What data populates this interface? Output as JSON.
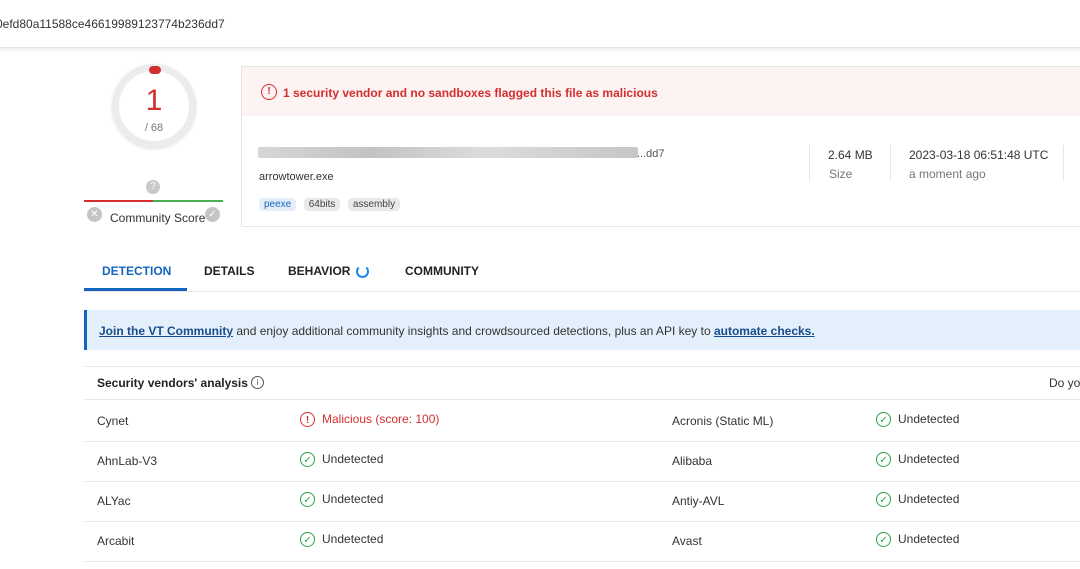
{
  "header": {
    "hash": "0efd80a11588ce46619989123774b236dd7"
  },
  "score": {
    "detections": "1",
    "total": "/ 68",
    "community_label": "Community Score",
    "question_icon": "?"
  },
  "file": {
    "alert": "1 security vendor and no sandboxes flagged this file as malicious",
    "hash_tail": "...dd7",
    "filename": "arrowtower.exe",
    "tags": [
      "peexe",
      "64bits",
      "assembly"
    ],
    "size_value": "2.64 MB",
    "size_label": "Size",
    "date_value": "2023-03-18 06:51:48 UTC",
    "date_label": "a moment ago"
  },
  "tabs": [
    "DETECTION",
    "DETAILS",
    "BEHAVIOR",
    "COMMUNITY"
  ],
  "banner": {
    "link1": "Join the VT Community",
    "middle": " and enjoy additional community insights and crowdsourced detections, plus an API key to ",
    "link2": "automate checks."
  },
  "vendors": {
    "title": "Security vendors' analysis",
    "right_text": "Do yo",
    "rows": [
      {
        "left": {
          "vendor": "Cynet",
          "result": "Malicious (score: 100)",
          "status": "malicious"
        },
        "right": {
          "vendor": "Acronis (Static ML)",
          "result": "Undetected",
          "status": "undetected"
        }
      },
      {
        "left": {
          "vendor": "AhnLab-V3",
          "result": "Undetected",
          "status": "undetected"
        },
        "right": {
          "vendor": "Alibaba",
          "result": "Undetected",
          "status": "undetected"
        }
      },
      {
        "left": {
          "vendor": "ALYac",
          "result": "Undetected",
          "status": "undetected"
        },
        "right": {
          "vendor": "Antiy-AVL",
          "result": "Undetected",
          "status": "undetected"
        }
      },
      {
        "left": {
          "vendor": "Arcabit",
          "result": "Undetected",
          "status": "undetected"
        },
        "right": {
          "vendor": "Avast",
          "result": "Undetected",
          "status": "undetected"
        }
      }
    ]
  },
  "colors": {
    "malicious": "#d32f2f",
    "undetected": "#2e9e44",
    "accent": "#1565c0"
  },
  "icons": {
    "alert": "alert-circle-icon",
    "ok": "check-circle-icon",
    "spinner": "loading-spinner-icon",
    "info": "info-icon"
  }
}
